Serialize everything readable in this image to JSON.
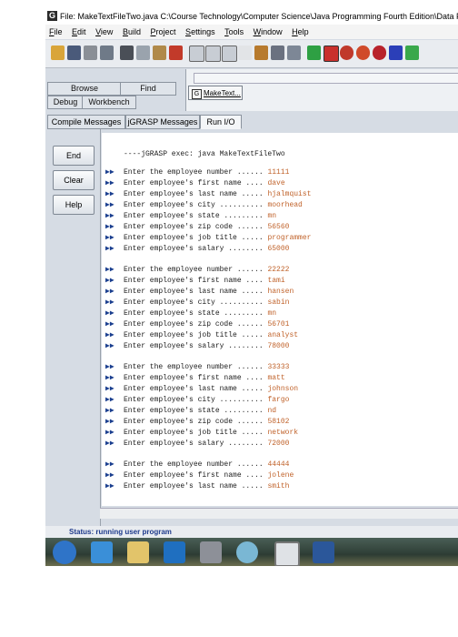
{
  "window": {
    "title_text": "File: MakeTextFileTwo.java  C:\\Course Technology\\Computer Science\\Java Programming Fourth Edition\\Data Files\\DAVE SC",
    "app_icon": "G"
  },
  "menu": [
    "File",
    "Edit",
    "View",
    "Build",
    "Project",
    "Settings",
    "Tools",
    "Window",
    "Help"
  ],
  "left_panel": {
    "tabs_row1": [
      "Browse",
      "Find"
    ],
    "tabs_row2": [
      "Debug",
      "Workbench"
    ]
  },
  "file_tab": {
    "label": "MakeText..."
  },
  "message_tabs": [
    "Compile Messages",
    "jGRASP Messages",
    "Run I/O"
  ],
  "side_buttons": {
    "end": "End",
    "clear": "Clear",
    "help": "Help"
  },
  "console": {
    "exec_line": "----jGRASP exec: java MakeTextFileTwo",
    "prompts": {
      "number": "Enter the employee number ...... ",
      "first": "Enter employee's first name .... ",
      "last": "Enter employee's last name ..... ",
      "city": "Enter employee's city .......... ",
      "state": "Enter employee's state ......... ",
      "zip": "Enter employee's zip code ...... ",
      "title": "Enter employee's job title ..... ",
      "salary": "Enter employee's salary ........ "
    },
    "records": [
      {
        "number": "11111",
        "first": "dave",
        "last": "hjalmquist",
        "city": "moorhead",
        "state": "mn",
        "zip": "56560",
        "title": "programmer",
        "salary": "65000"
      },
      {
        "number": "22222",
        "first": "tami",
        "last": "hansen",
        "city": "sabin",
        "state": "mn",
        "zip": "56701",
        "title": "analyst",
        "salary": "78000"
      },
      {
        "number": "33333",
        "first": "matt",
        "last": "johnson",
        "city": "fargo",
        "state": "nd",
        "zip": "58102",
        "title": "network",
        "salary": "72000"
      },
      {
        "number": "44444",
        "first": "jolene",
        "last": "smith"
      }
    ]
  },
  "status": {
    "text": "Status: running user program"
  },
  "colors": {
    "prompt_arrow": "#1b3f8f",
    "input_value": "#c0622a",
    "status_text": "#1e3a8c"
  }
}
